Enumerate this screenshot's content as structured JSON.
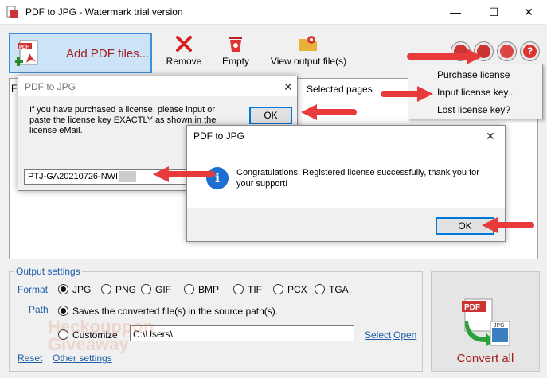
{
  "window": {
    "title": "PDF to JPG - Watermark trial version",
    "minimize": "—",
    "maximize": "☐",
    "close": "✕"
  },
  "toolbar": {
    "add_pdf_label": "Add PDF files...",
    "remove_label": "Remove",
    "empty_label": "Empty",
    "view_output_label": "View output file(s)"
  },
  "list": {
    "selected_pages_header": "Selected pages"
  },
  "menu": {
    "items": [
      "Purchase license",
      "Input license key...",
      "Lost license key?"
    ]
  },
  "license_dialog": {
    "title": "PDF to JPG",
    "message": "If you have purchased a license, please input or paste the license key EXACTLY as shown in the license eMail.",
    "ok_label": "OK",
    "key_value": "PTJ-GA20210726-NWI",
    "close": "✕"
  },
  "success_dialog": {
    "title": "PDF to JPG",
    "message": "Congratulations! Registered license successfully, thank you for your support!",
    "ok_label": "OK",
    "close": "✕",
    "info_icon": "i"
  },
  "output": {
    "group_title": "Output settings",
    "format_label": "Format",
    "formats": [
      "JPG",
      "PNG",
      "GIF",
      "BMP",
      "TIF",
      "PCX",
      "TGA"
    ],
    "selected_format": "JPG",
    "path_label": "Path",
    "source_path_option": "Saves the converted file(s) in the source path(s).",
    "customize_option": "Customize",
    "customize_value": "C:\\Users\\",
    "select_link": "Select",
    "open_link": "Open",
    "reset_link": "Reset",
    "other_settings_link": "Other settings"
  },
  "convert": {
    "label": "Convert all",
    "pdf_badge": "PDF",
    "jpg_badge": "JPG"
  },
  "watermark": {
    "line1": "Heckouppon",
    "line2": "Giveaway"
  },
  "colors": {
    "accent": "#0078d7",
    "brand_red": "#a32020",
    "arrow_red": "#e83a3a",
    "link_blue": "#1f5fa8"
  }
}
